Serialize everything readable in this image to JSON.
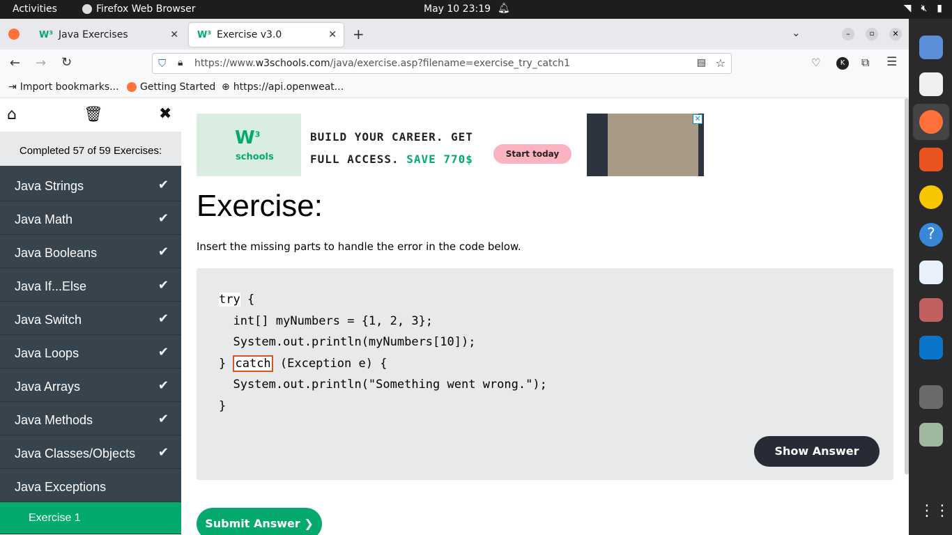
{
  "system": {
    "activities": "Activities",
    "app_name": "Firefox Web Browser",
    "clock": "May 10  23:19"
  },
  "tabs": [
    {
      "label": "Java Exercises",
      "active": false
    },
    {
      "label": "Exercise v3.0",
      "active": true
    }
  ],
  "address": {
    "url_pre": "https://www.",
    "url_host": "w3schools.com",
    "url_post": "/java/exercise.asp?filename=exercise_try_catch1"
  },
  "bookmarks": [
    "Import bookmarks...",
    "Getting Started",
    "https://api.openweat..."
  ],
  "sidebar": {
    "completed": "Completed 57 of 59 Exercises:",
    "items": [
      {
        "label": "Java Strings",
        "done": true
      },
      {
        "label": "Java Math",
        "done": true
      },
      {
        "label": "Java Booleans",
        "done": true
      },
      {
        "label": "Java If...Else",
        "done": true
      },
      {
        "label": "Java Switch",
        "done": true
      },
      {
        "label": "Java Loops",
        "done": true
      },
      {
        "label": "Java Arrays",
        "done": true
      },
      {
        "label": "Java Methods",
        "done": true
      },
      {
        "label": "Java Classes/Objects",
        "done": true
      },
      {
        "label": "Java Exceptions",
        "done": false
      }
    ],
    "sub_item": "Exercise 1"
  },
  "ad": {
    "logo_text": "schools",
    "line1": "BUILD YOUR CAREER. GET",
    "line2_a": "FULL ACCESS. ",
    "line2_b": "SAVE 770$",
    "cta": "Start today"
  },
  "exercise": {
    "title": "Exercise:",
    "instruction": "Insert the missing parts to handle the error in the code below.",
    "code": {
      "kw_try": "try",
      "l1_rest": " {",
      "l2": "  int[] myNumbers = {1, 2, 3};",
      "l3": "  System.out.println(myNumbers[10]);",
      "l4_pre": "} ",
      "answer": "catch",
      "l4_post": " (Exception e) {",
      "l5": "  System.out.println(\"Something went wrong.\");",
      "l6": "}"
    },
    "show_answer": "Show Answer",
    "submit": "Submit Answer ❯"
  },
  "colors": {
    "accent": "#04aa6d",
    "sidebar": "#38444d",
    "dark_button": "#282a35"
  }
}
